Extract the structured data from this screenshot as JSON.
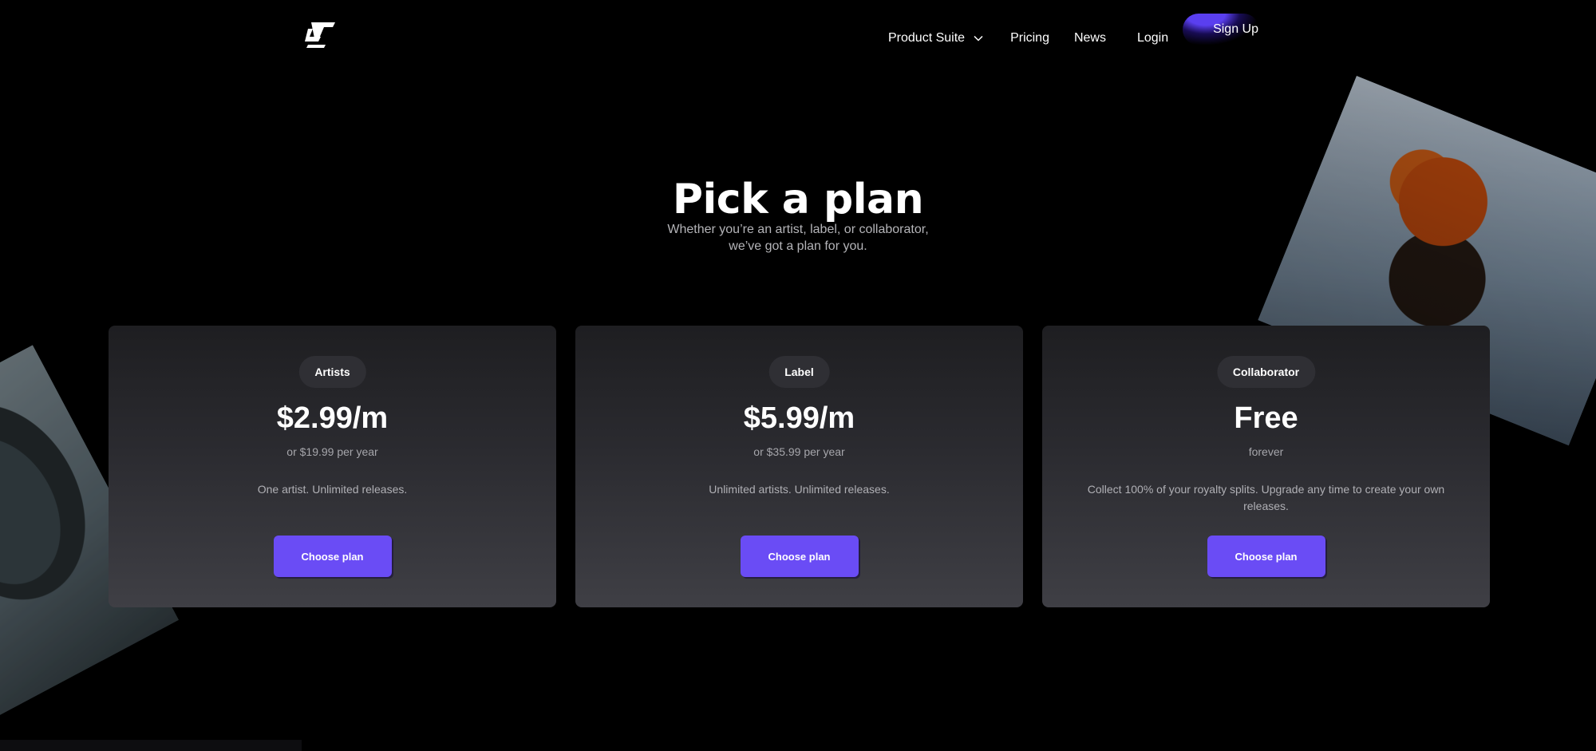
{
  "nav": {
    "logo_icon": "lt-logo-icon",
    "product_suite": "Product Suite",
    "pricing": "Pricing",
    "news": "News",
    "login": "Login",
    "signup": "Sign Up"
  },
  "hero": {
    "title": "Pick a plan",
    "subtitle_line1": "Whether you’re an artist, label, or collaborator,",
    "subtitle_line2": "we’ve got a plan for you."
  },
  "plans": [
    {
      "tag": "Artists",
      "price": "$2.99/m",
      "period": "or $19.99 per year",
      "description": "One artist. Unlimited releases.",
      "button": "Choose plan"
    },
    {
      "tag": "Label",
      "price": "$5.99/m",
      "period": "or $35.99 per year",
      "description": "Unlimited artists. Unlimited releases.",
      "button": "Choose plan"
    },
    {
      "tag": "Collaborator",
      "price": "Free",
      "period": "forever",
      "description": "Collect 100% of your royalty splits. Upgrade any time to create your own releases.",
      "button": "Choose plan"
    }
  ],
  "colors": {
    "background": "#000000",
    "accent": "#6a4cf5",
    "card_top": "#1e1e21",
    "card_bottom": "#3f3f45"
  }
}
